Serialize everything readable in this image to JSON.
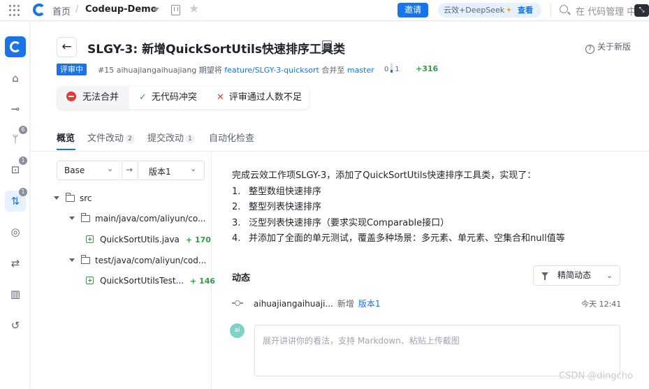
{
  "topbar": {
    "home": "首页",
    "separator": "/",
    "project": "Codeup-Demo",
    "invite": "邀请",
    "ai_chip": {
      "label": "云效+DeepSeek",
      "action": "查看"
    },
    "search_placeholder": "在 代码管理 中"
  },
  "sidebar": {
    "items": [
      {
        "icon": "home-icon",
        "glyph": "⌂"
      },
      {
        "icon": "commit-icon",
        "glyph": "⊸"
      },
      {
        "icon": "branch-icon",
        "glyph": "ᛘ",
        "badge": "6"
      },
      {
        "icon": "tag-icon",
        "glyph": "⊡",
        "badge": "1"
      },
      {
        "icon": "merge-request-icon",
        "glyph": "⇅",
        "badge": "1",
        "active": true
      },
      {
        "icon": "target-icon",
        "glyph": "◎"
      },
      {
        "icon": "sync-icon",
        "glyph": "⇄"
      },
      {
        "icon": "stats-icon",
        "glyph": "▥"
      },
      {
        "icon": "history-icon",
        "glyph": "↺"
      }
    ]
  },
  "header": {
    "title": "SLGY-3: 新增QuickSortUtils快速排序工具类",
    "whats_new": "关于新版",
    "status": "评审中",
    "meta_prefix": "#15 aihuajiangaihuajiang 期望将 ",
    "source_branch": "feature/SLGY-3-quicksort",
    "meta_middle": " 合并至 ",
    "target_branch": "master",
    "diff_deleted": "0",
    "diff_added_small": "1",
    "diff_added": "+316"
  },
  "checks": {
    "merge": "无法合并",
    "conflict": "无代码冲突",
    "reviewers": "评审通过人数不足"
  },
  "tabs": [
    {
      "label": "概览",
      "count": ""
    },
    {
      "label": "文件改动",
      "count": "2"
    },
    {
      "label": "提交改动",
      "count": "1"
    },
    {
      "label": "自动化检查",
      "count": ""
    }
  ],
  "version_select": {
    "base": "Base",
    "arrow": "→",
    "target": "版本1"
  },
  "file_tree": {
    "root": "src",
    "dir1": "main/java/com/aliyun/co...",
    "file1": {
      "name": "QuickSortUtils.java",
      "added": "+ 170"
    },
    "dir2": "test/java/com/aliyun/cod...",
    "file2": {
      "name": "QuickSortUtilsTest...",
      "added": "+ 146"
    }
  },
  "description": {
    "intro": "完成云效工作项SLGY-3，添加了QuickSortUtils快速排序工具类，实现了：",
    "items": [
      {
        "num": "1.",
        "text": "整型数组快速排序"
      },
      {
        "num": "2.",
        "text": "整型列表快速排序"
      },
      {
        "num": "3.",
        "text": "泛型列表快速排序（要求实现Comparable接口）"
      },
      {
        "num": "4.",
        "text": "并添加了全面的单元测试，覆盖多种场景：多元素、单元素、空集合和null值等"
      }
    ]
  },
  "activity": {
    "title": "动态",
    "filter": "精简动态",
    "entry": {
      "user": "aihuajiangaihuaji...",
      "verb": "新增",
      "version": "版本1",
      "time": "今天 12:41"
    },
    "avatar": "ai",
    "comment_placeholder": "展开讲讲你的看法，支持 Markdown、粘贴上传截图"
  },
  "watermark": "CSDN @dingcho"
}
